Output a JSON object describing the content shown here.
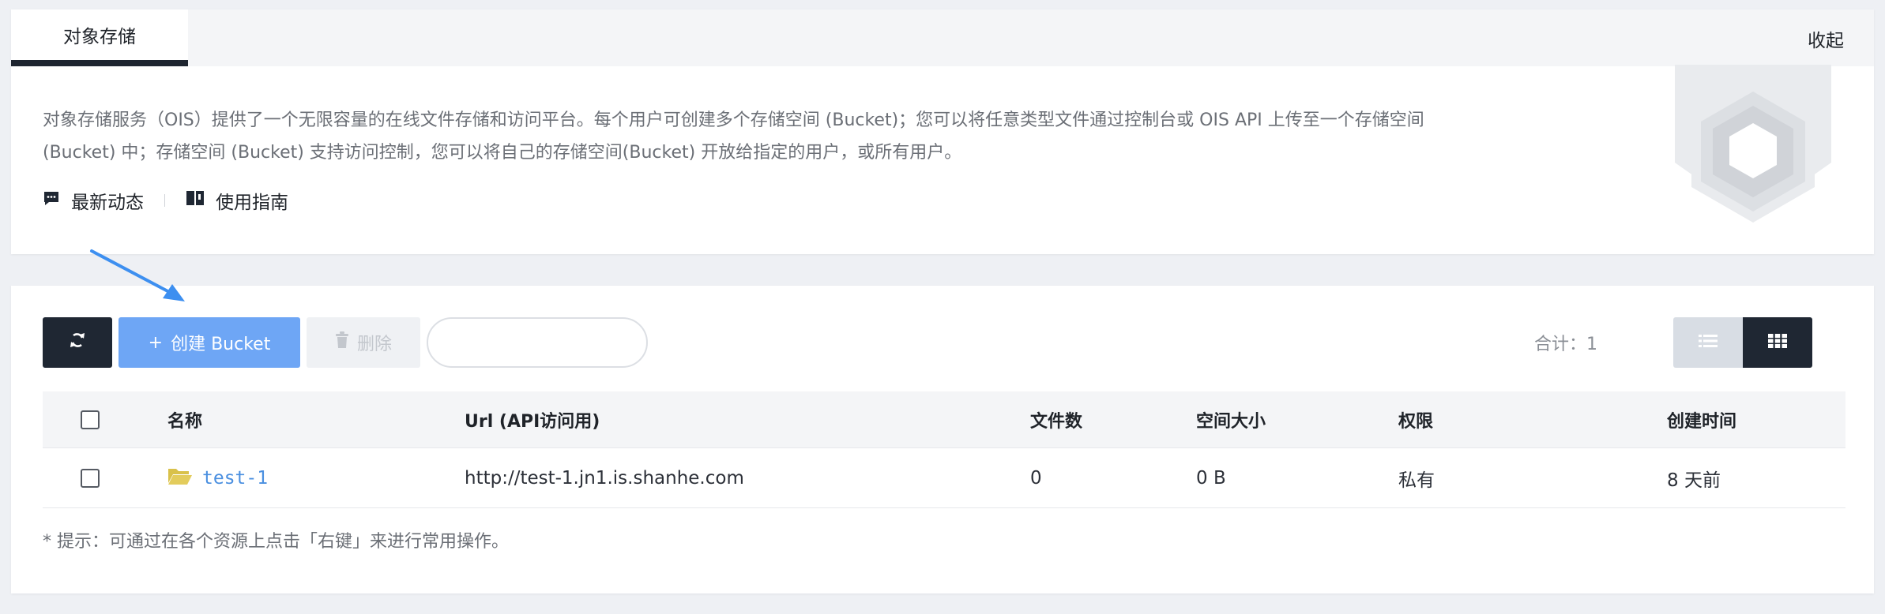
{
  "header": {
    "active_tab": "对象存储",
    "collapse_label": "收起"
  },
  "intro": {
    "description_line1": "对象存储服务（OIS）提供了一个无限容量的在线文件存储和访问平台。每个用户可创建多个存储空间 (Bucket)；您可以将任意类型文件通过控制台或 OIS API 上传至一个存储空间",
    "description_line2": "(Bucket) 中；存储空间 (Bucket) 支持访问控制，您可以将自己的存储空间(Bucket) 开放给指定的用户，或所有用户。",
    "links": [
      {
        "label": "最新动态",
        "icon": "message-icon"
      },
      {
        "label": "使用指南",
        "icon": "book-icon"
      }
    ]
  },
  "toolbar": {
    "refresh_icon": "refresh-icon",
    "create_label": "创建 Bucket",
    "create_prefix": "+",
    "delete_label": "删除",
    "search_value": "",
    "search_placeholder": "",
    "total_label": "合计：1",
    "view_modes": [
      "list",
      "grid"
    ],
    "active_view": "grid"
  },
  "table": {
    "columns": [
      "名称",
      "Url (API访问用)",
      "文件数",
      "空间大小",
      "权限",
      "创建时间"
    ],
    "rows": [
      {
        "name": "test-1",
        "url": "http://test-1.jn1.is.shanhe.com",
        "files": "0",
        "size": "0 B",
        "permission": "私有",
        "created": "8 天前"
      }
    ]
  },
  "footer": {
    "tip": "* 提示：可通过在各个资源上点击「右键」来进行常用操作。"
  },
  "colors": {
    "dark": "#1f2733",
    "primary_light": "#6ea6f5",
    "link": "#4a8fe0",
    "folder": "#d9c14a",
    "annotation_arrow": "#3d8ff0"
  }
}
